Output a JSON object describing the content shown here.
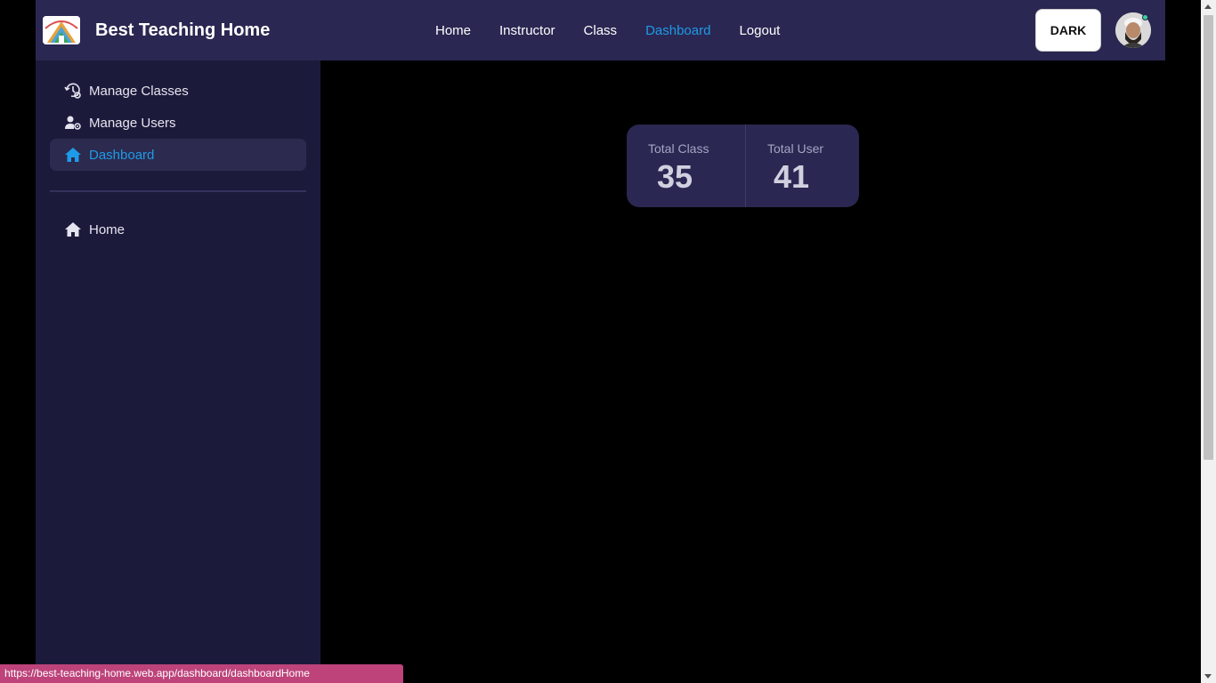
{
  "brand": {
    "title": "Best Teaching Home",
    "logo_icon": "house-logo-icon"
  },
  "nav": {
    "links": [
      {
        "label": "Home",
        "active": false
      },
      {
        "label": "Instructor",
        "active": false
      },
      {
        "label": "Class",
        "active": false
      },
      {
        "label": "Dashboard",
        "active": true
      },
      {
        "label": "Logout",
        "active": false
      }
    ],
    "theme_button": "DARK"
  },
  "sidebar": {
    "items": [
      {
        "label": "Manage Classes",
        "icon": "manage-classes-icon",
        "active": false
      },
      {
        "label": "Manage Users",
        "icon": "manage-users-icon",
        "active": false
      },
      {
        "label": "Dashboard",
        "icon": "home-icon",
        "active": true
      }
    ],
    "bottom_items": [
      {
        "label": "Home",
        "icon": "home-icon",
        "active": false
      }
    ]
  },
  "stats": [
    {
      "title": "Total Class",
      "value": "35"
    },
    {
      "title": "Total User",
      "value": "41"
    }
  ],
  "status_url": "https://best-teaching-home.web.app/dashboard/dashboardHome",
  "colors": {
    "navbar": "#2a2752",
    "sidebar": "#1c1a3b",
    "accent": "#1e9be8",
    "stat_card": "#2a2752",
    "status_bar": "#bd437a"
  }
}
